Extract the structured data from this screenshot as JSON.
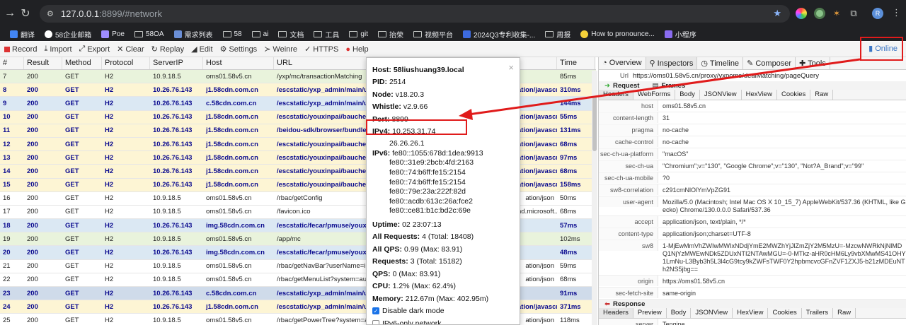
{
  "browser": {
    "url_host": "127.0.0.1",
    "url_rest": ":8899/#network",
    "profile_initial": "R"
  },
  "bookmarks": [
    {
      "label": "翻译",
      "icon": "translate-icon",
      "color": "#4285f4"
    },
    {
      "label": "58企业邮箱",
      "icon": "mail-icon",
      "color": "#ffffff"
    },
    {
      "label": "Poe",
      "icon": "poe-icon",
      "color": "#9e8cff"
    },
    {
      "label": "58OA",
      "icon": "folder-icon",
      "color": ""
    },
    {
      "label": "需求列表",
      "icon": "stack-icon",
      "color": "#6b8fd6"
    },
    {
      "label": "58",
      "icon": "folder-icon",
      "color": ""
    },
    {
      "label": "ai",
      "icon": "folder-icon",
      "color": ""
    },
    {
      "label": "文档",
      "icon": "folder-icon",
      "color": ""
    },
    {
      "label": "工具",
      "icon": "folder-icon",
      "color": ""
    },
    {
      "label": "git",
      "icon": "folder-icon",
      "color": ""
    },
    {
      "label": "抬荣",
      "icon": "folder-icon",
      "color": ""
    },
    {
      "label": "视频平台",
      "icon": "folder-icon",
      "color": ""
    },
    {
      "label": "2024Q3专利收集-...",
      "icon": "doc-icon",
      "color": "#3d6be0"
    },
    {
      "label": "周报",
      "icon": "folder-icon",
      "color": ""
    },
    {
      "label": "How to pronounce...",
      "icon": "yellow-circle-icon",
      "color": "#f4d13a"
    },
    {
      "label": "小程序",
      "icon": "link-icon",
      "color": "#8a6cf0"
    }
  ],
  "toolbar": {
    "record": "Record",
    "import": "Import",
    "export": "Export",
    "clear": "Clear",
    "replay": "Replay",
    "edit": "Edit",
    "settings": "Settings",
    "weinre": "Weinre",
    "https": "HTTPS",
    "help": "Help",
    "online": "Online"
  },
  "grid": {
    "columns": [
      "#",
      "Result",
      "Method",
      "Protocol",
      "ServerIP",
      "Host",
      "URL",
      "",
      "Time"
    ],
    "rows": [
      {
        "n": "7",
        "result": "200",
        "method": "GET",
        "proto": "H2",
        "ip": "10.9.18.5",
        "host": "oms01.58v5.cn",
        "url": "/yxp/mc/transactionMatching",
        "type": "",
        "time": "85ms",
        "style": "g",
        "bold": false
      },
      {
        "n": "8",
        "result": "200",
        "method": "GET",
        "proto": "H2",
        "ip": "10.26.76.143",
        "host": "j1.58cdn.com.cn",
        "url": "/escstatic/yxp_admin/main/umi",
        "type": "ation/javascript",
        "time": "310ms",
        "style": "y",
        "bold": true
      },
      {
        "n": "9",
        "result": "200",
        "method": "GET",
        "proto": "H2",
        "ip": "10.26.76.143",
        "host": "c.58cdn.com.cn",
        "url": "/escstatic/yxp_admin/main/umi",
        "type": "",
        "time": "144ms",
        "style": "bl",
        "bold": true
      },
      {
        "n": "10",
        "result": "200",
        "method": "GET",
        "proto": "H2",
        "ip": "10.26.76.143",
        "host": "j1.58cdn.com.cn",
        "url": "/escstatic/youxinpai/bauchesd",
        "type": "ation/javascript",
        "time": "55ms",
        "style": "y",
        "bold": true
      },
      {
        "n": "11",
        "result": "200",
        "method": "GET",
        "proto": "H2",
        "ip": "10.26.76.143",
        "host": "j1.58cdn.com.cn",
        "url": "/beidou-sdk/browser/bundle.m",
        "type": "ation/javascript",
        "time": "131ms",
        "style": "y",
        "bold": true
      },
      {
        "n": "12",
        "result": "200",
        "method": "GET",
        "proto": "H2",
        "ip": "10.26.76.143",
        "host": "j1.58cdn.com.cn",
        "url": "/escstatic/youxinpai/bauchesd",
        "type": "ation/javascript",
        "time": "68ms",
        "style": "y",
        "bold": true
      },
      {
        "n": "13",
        "result": "200",
        "method": "GET",
        "proto": "H2",
        "ip": "10.26.76.143",
        "host": "j1.58cdn.com.cn",
        "url": "/escstatic/youxinpai/bauchesd",
        "type": "ation/javascript",
        "time": "97ms",
        "style": "y",
        "bold": true
      },
      {
        "n": "14",
        "result": "200",
        "method": "GET",
        "proto": "H2",
        "ip": "10.26.76.143",
        "host": "j1.58cdn.com.cn",
        "url": "/escstatic/youxinpai/bauchesd",
        "type": "ation/javascript",
        "time": "68ms",
        "style": "y",
        "bold": true
      },
      {
        "n": "15",
        "result": "200",
        "method": "GET",
        "proto": "H2",
        "ip": "10.26.76.143",
        "host": "j1.58cdn.com.cn",
        "url": "/escstatic/youxinpai/bauchesd",
        "type": "ation/javascript",
        "time": "158ms",
        "style": "y",
        "bold": true
      },
      {
        "n": "16",
        "result": "200",
        "method": "GET",
        "proto": "H2",
        "ip": "10.9.18.5",
        "host": "oms01.58v5.cn",
        "url": "/rbac/getConfig",
        "type": "ation/json",
        "time": "50ms",
        "style": "w",
        "bold": false
      },
      {
        "n": "17",
        "result": "200",
        "method": "GET",
        "proto": "H2",
        "ip": "10.9.18.5",
        "host": "oms01.58v5.cn",
        "url": "/favicon.ico",
        "type": "nd.microsoft...",
        "time": "68ms",
        "style": "w",
        "bold": false
      },
      {
        "n": "18",
        "result": "200",
        "method": "GET",
        "proto": "H2",
        "ip": "10.26.76.143",
        "host": "img.58cdn.com.cn",
        "url": "/escstatic/fecar/pmuse/youxin",
        "type": "",
        "time": "57ms",
        "style": "bl",
        "bold": true
      },
      {
        "n": "19",
        "result": "200",
        "method": "GET",
        "proto": "H2",
        "ip": "10.9.18.5",
        "host": "oms01.58v5.cn",
        "url": "/app/mc",
        "type": "",
        "time": "102ms",
        "style": "g",
        "bold": false
      },
      {
        "n": "20",
        "result": "200",
        "method": "GET",
        "proto": "H2",
        "ip": "10.26.76.143",
        "host": "img.58cdn.com.cn",
        "url": "/escstatic/fecar/pmuse/youxin",
        "type": "",
        "time": "48ms",
        "style": "bl",
        "bold": true
      },
      {
        "n": "21",
        "result": "200",
        "method": "GET",
        "proto": "H2",
        "ip": "10.9.18.5",
        "host": "oms01.58v5.cn",
        "url": "/rbac/getNavBar?userName=ilus",
        "type": "ation/json",
        "time": "59ms",
        "style": "w",
        "bold": false
      },
      {
        "n": "22",
        "result": "200",
        "method": "GET",
        "proto": "H2",
        "ip": "10.9.18.5",
        "host": "oms01.58v5.cn",
        "url": "/rbac/getMenuList?system=auc",
        "type": "ation/json",
        "time": "68ms",
        "style": "w",
        "bold": false
      },
      {
        "n": "23",
        "result": "200",
        "method": "GET",
        "proto": "H2",
        "ip": "10.26.76.143",
        "host": "c.58cdn.com.cn",
        "url": "/escstatic/yxp_admin/main/umi",
        "type": "",
        "time": "91ms",
        "style": "sel",
        "bold": true
      },
      {
        "n": "24",
        "result": "200",
        "method": "GET",
        "proto": "H2",
        "ip": "10.26.76.143",
        "host": "j1.58cdn.com.cn",
        "url": "/escstatic/yxp_admin/main/umi",
        "type": "ation/javascript",
        "time": "371ms",
        "style": "y",
        "bold": true
      },
      {
        "n": "25",
        "result": "200",
        "method": "GET",
        "proto": "H2",
        "ip": "10.9.18.5",
        "host": "oms01.58v5.cn",
        "url": "/rbac/getPowerTree?system=aud",
        "type": "ation/json",
        "time": "118ms",
        "style": "w",
        "bold": false
      }
    ]
  },
  "popup": {
    "host": "58liushuang39.local",
    "pid": "2514",
    "node": "v18.20.3",
    "whistle": "v2.9.66",
    "port": "8899",
    "ipv4": [
      "10.253.31.74",
      "26.26.26.1"
    ],
    "ipv6": [
      "fe80::1055:678d:1dea:9913",
      "fe80::31e9:2bcb:4fd:2163",
      "fe80::74:b6ff:fe15:2154",
      "fe80::74:b6ff:fe15:2154",
      "fe80::79e:23a:222f:82d",
      "fe80::acdb:613c:26a:fce2",
      "fe80::ce81:b1c:bd2c:69e"
    ],
    "uptime": "02 23:07:13",
    "all_requests": "4 (Total: 18408)",
    "all_qps": "0.99 (Max: 83.91)",
    "requests": "3 (Total: 15182)",
    "qps": "0 (Max: 83.91)",
    "cpu": "1.2% (Max: 62.4%)",
    "memory": "212.67m (Max: 402.95m)",
    "dark_mode": "Disable dark mode",
    "ipv6_only": "IPv6-only network",
    "labels": {
      "host": "Host:",
      "pid": "PID:",
      "node": "Node:",
      "whistle": "Whistle:",
      "port": "Port:",
      "ipv4": "IPv4:",
      "ipv6": "IPv6:",
      "uptime": "Uptime:",
      "all_requests": "All Requests:",
      "all_qps": "All QPS:",
      "requests": "Requests:",
      "qps": "QPS:",
      "cpu": "CPU:",
      "memory": "Memory:"
    }
  },
  "inspector": {
    "tabs": [
      "Overview",
      "Inspectors",
      "Timeline",
      "Composer",
      "Tools"
    ],
    "url_label": "Url",
    "url": "https://oms01.58v5.cn/proxy/yxpoms/dealMatching/pageQuery",
    "request_label": "Request",
    "frames_label": "Frames",
    "req_tabs": [
      "Headers",
      "WebForms",
      "Body",
      "JSONView",
      "HexView",
      "Cookies",
      "Raw"
    ],
    "headers": [
      {
        "k": "host",
        "v": "oms01.58v5.cn"
      },
      {
        "k": "content-length",
        "v": "31"
      },
      {
        "k": "pragma",
        "v": "no-cache"
      },
      {
        "k": "cache-control",
        "v": "no-cache"
      },
      {
        "k": "sec-ch-ua-platform",
        "v": "\"macOS\""
      },
      {
        "k": "sec-ch-ua",
        "v": "\"Chromium\";v=\"130\", \"Google Chrome\";v=\"130\", \"Not?A_Brand\";v=\"99\""
      },
      {
        "k": "sec-ch-ua-mobile",
        "v": "?0"
      },
      {
        "k": "sw8-correlation",
        "v": "c291cmNlOlYmVpZG91"
      },
      {
        "k": "user-agent",
        "v": "Mozilla/5.0 (Macintosh; Intel Mac OS X 10_15_7) AppleWebKit/537.36 (KHTML, like Gecko) Chrome/130.0.0.0 Safari/537.36"
      },
      {
        "k": "accept",
        "v": "application/json, text/plain, */*"
      },
      {
        "k": "content-type",
        "v": "application/json;charset=UTF-8"
      },
      {
        "k": "sw8",
        "v": "1-MjEwMmVhZWIwMWIxNDdjYmE2MWZhYjJlZmZjY2M5MzU=-MzcwNWRkNjNlMDQ1NjYzMWEwNDk5ZDUxNTI2NTAwMGU=-0-MTkz-aHR0cHM6Ly9vbXMwMS41OHY1LmNu-L3Byb3h5L3l4cG9tcy9kZWFsTWF0Y2hpbmcvcGFnZVF1ZXJ5-b21zMDEuNTh2NS5jbg=="
      },
      {
        "k": "origin",
        "v": "https://oms01.58v5.cn"
      },
      {
        "k": "sec-fetch-site",
        "v": "same-origin"
      }
    ],
    "response_label": "Response",
    "res_tabs": [
      "Headers",
      "Preview",
      "Body",
      "JSONView",
      "HexView",
      "Cookies",
      "Trailers",
      "Raw"
    ],
    "res_headers": [
      {
        "k": "server",
        "v": "Tengine"
      }
    ]
  },
  "colors": {
    "annotation": "#e01b1b",
    "accent": "#3a75c4"
  }
}
